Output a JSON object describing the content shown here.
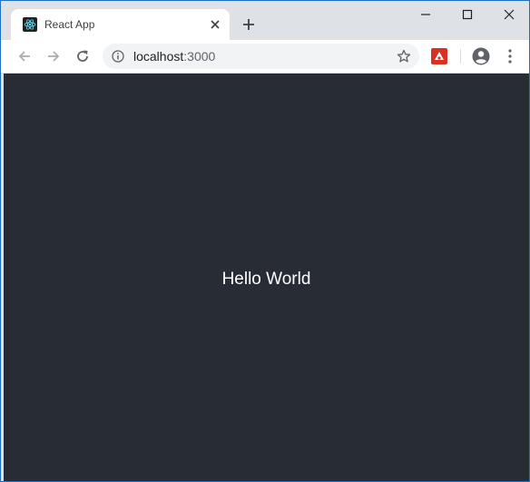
{
  "browser": {
    "tab": {
      "title": "React App",
      "favicon": "react-logo-icon"
    },
    "new_tab_icon": "plus-icon",
    "window_controls": [
      "minimize-icon",
      "maximize-icon",
      "close-icon"
    ],
    "address_bar": {
      "host": "localhost",
      "port": ":3000",
      "info_icon": "info-icon",
      "bookmark_icon": "star-icon"
    },
    "nav": [
      "back-arrow-icon",
      "forward-arrow-icon",
      "reload-icon"
    ],
    "extension_icon": "extension-icon",
    "profile_icon": "account-circle-icon",
    "menu_icon": "kebab-menu-icon"
  },
  "page": {
    "background": "#282c34",
    "text_color": "#ffffff",
    "message": "Hello World"
  },
  "colors": {
    "react_accent": "#61dafb",
    "window_border": "#1d6fbf",
    "tabstrip": "#dee1e6"
  }
}
